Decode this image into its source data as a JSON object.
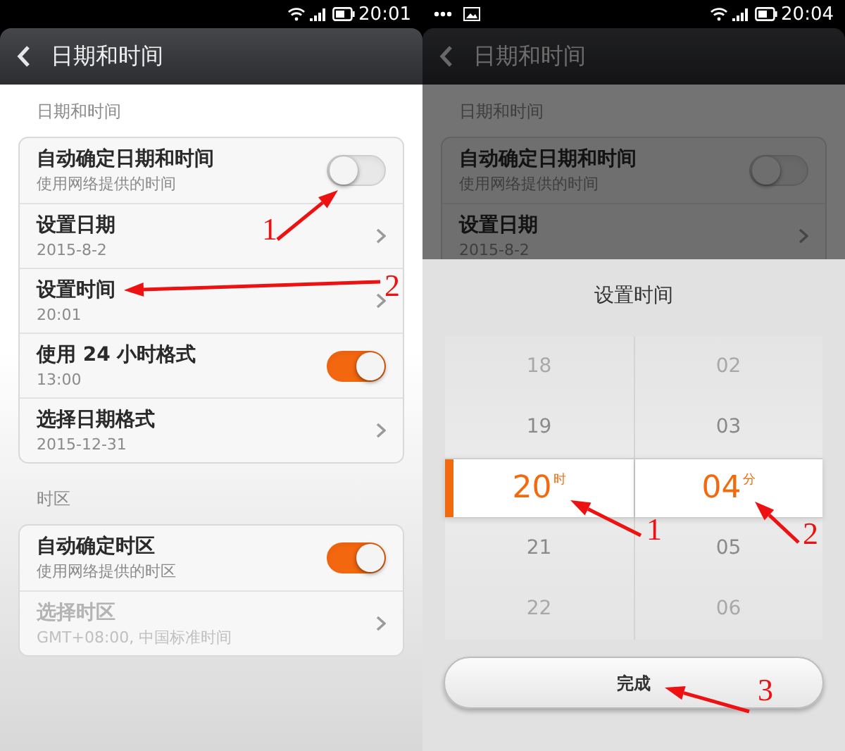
{
  "screens": [
    {
      "status_bar": {
        "time": "20:01"
      },
      "header": {
        "title": "日期和时间"
      },
      "sections": [
        {
          "title": "日期和时间",
          "rows": [
            {
              "kind": "switch",
              "title": "自动确定日期和时间",
              "subtitle": "使用网络提供的时间",
              "on": false,
              "disabled": false
            },
            {
              "kind": "link",
              "title": "设置日期",
              "subtitle": "2015-8-2",
              "disabled": false
            },
            {
              "kind": "link",
              "title": "设置时间",
              "subtitle": "20:01",
              "disabled": false
            },
            {
              "kind": "switch",
              "title": "使用 24 小时格式",
              "subtitle": "13:00",
              "on": true,
              "disabled": false
            },
            {
              "kind": "link",
              "title": "选择日期格式",
              "subtitle": "2015-12-31",
              "disabled": false
            }
          ]
        },
        {
          "title": "时区",
          "rows": [
            {
              "kind": "switch",
              "title": "自动确定时区",
              "subtitle": "使用网络提供的时区",
              "on": true,
              "disabled": false
            },
            {
              "kind": "link",
              "title": "选择时区",
              "subtitle": "GMT+08:00, 中国标准时间",
              "disabled": true
            }
          ]
        }
      ],
      "annotations": [
        {
          "label": "1"
        },
        {
          "label": "2"
        }
      ]
    },
    {
      "status_bar": {
        "notifications": [
          {
            "kind": "more"
          },
          {
            "kind": "image"
          }
        ],
        "time": "20:04"
      },
      "header": {
        "title": "日期和时间"
      },
      "sections": [
        {
          "title": "日期和时间",
          "rows": [
            {
              "kind": "switch",
              "title": "自动确定日期和时间",
              "subtitle": "使用网络提供的时间",
              "on": false,
              "disabled": false
            },
            {
              "kind": "link",
              "title": "设置日期",
              "subtitle": "2015-8-2",
              "disabled": false
            }
          ]
        }
      ],
      "dialog": {
        "title": "设置时间",
        "columns": [
          {
            "unit": "时",
            "items": [
              {
                "value": "18",
                "selected": false
              },
              {
                "value": "19",
                "selected": false
              },
              {
                "value": "20",
                "selected": true
              },
              {
                "value": "21",
                "selected": false
              },
              {
                "value": "22",
                "selected": false
              }
            ]
          },
          {
            "unit": "分",
            "items": [
              {
                "value": "02",
                "selected": false
              },
              {
                "value": "03",
                "selected": false
              },
              {
                "value": "04",
                "selected": true
              },
              {
                "value": "05",
                "selected": false
              },
              {
                "value": "06",
                "selected": false
              }
            ]
          }
        ],
        "done_button": "完成"
      },
      "annotations": [
        {
          "label": "1"
        },
        {
          "label": "2"
        },
        {
          "label": "3"
        }
      ]
    }
  ]
}
